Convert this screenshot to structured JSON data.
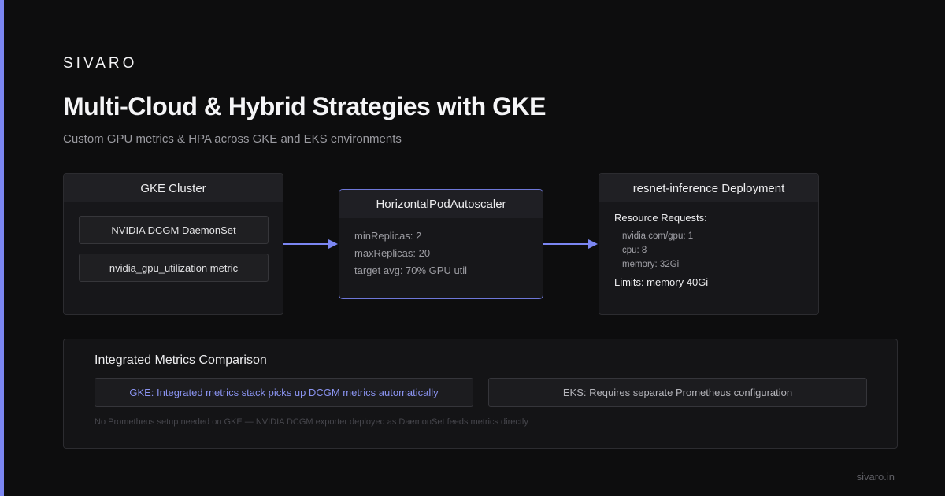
{
  "brand": "SIVARO",
  "title": "Multi-Cloud & Hybrid Strategies with GKE",
  "subtitle": "Custom GPU metrics & HPA across GKE and EKS environments",
  "gke_cluster": {
    "header": "GKE Cluster",
    "items": [
      "NVIDIA DCGM DaemonSet",
      "nvidia_gpu_utilization metric"
    ]
  },
  "hpa": {
    "header": "HorizontalPodAutoscaler",
    "lines": [
      "minReplicas: 2",
      "maxReplicas: 20",
      "target avg: 70% GPU util"
    ]
  },
  "deployment": {
    "header": "resnet-inference Deployment",
    "requests_title": "Resource Requests:",
    "requests": [
      "nvidia.com/gpu: 1",
      "cpu: 8",
      "memory: 32Gi"
    ],
    "limits": "Limits: memory 40Gi"
  },
  "comparison": {
    "title": "Integrated Metrics Comparison",
    "gke": "GKE: Integrated metrics stack picks up DCGM metrics automatically",
    "eks": "EKS: Requires separate Prometheus configuration",
    "note": "No Prometheus setup needed on GKE — NVIDIA DCGM exporter deployed as DaemonSet feeds metrics directly"
  },
  "footer": "sivaro.in",
  "colors": {
    "accent": "#7b86f2",
    "background": "#0d0d0e",
    "card": "#17171a"
  }
}
